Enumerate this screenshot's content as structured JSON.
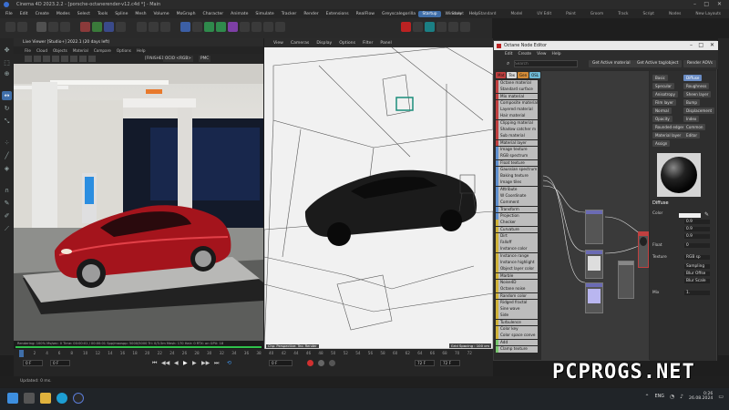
{
  "window": {
    "app_title": "Cinema 4D 2023.2.2 - [porsche-octanerender-v12.c4d *] - Main"
  },
  "menubar": {
    "items": [
      "File",
      "Edit",
      "Create",
      "Modes",
      "Select",
      "Tools",
      "Spline",
      "Mesh",
      "Volume",
      "MoGraph",
      "Character",
      "Animate",
      "Simulate",
      "Tracker",
      "Render",
      "Extensions",
      "RealFlow",
      "Greyscalegorilla",
      "Octane",
      "Window",
      "Help"
    ]
  },
  "layouts": {
    "tabs": [
      "Startup",
      "Sculpt",
      "Standard",
      "Model",
      "UV Edit",
      "Paint",
      "Groom",
      "Track",
      "Script",
      "Nodes"
    ],
    "active": "Startup",
    "new_layouts_label": "New Layouts"
  },
  "live_viewer": {
    "title": "Live Viewer [Studio+] 2022.1 (20 days left)",
    "menu": [
      "File",
      "Cloud",
      "Objects",
      "Material",
      "Compare",
      "Options",
      "Help"
    ],
    "mode": "[FINISHED]",
    "color_space": "OCIO <RGB>",
    "pmc": "PMC",
    "status": "Rendering: 100%  Ms/sec: 0  Time: 00:00:01 / 00:00:01  Spp/maxspp: 5000/5000  Tri: 0/3.5m  Mesh: 170  Hair: 0  RTX: on  GPU: 18",
    "progress": 1.0
  },
  "viewport": {
    "menu": [
      "View",
      "Cameras",
      "Display",
      "Options",
      "Filter",
      "Panel"
    ],
    "footer": "Grid Spacing : 100 cm",
    "label_left": "Chp: Perspective: Tex: Render",
    "scene_note": ""
  },
  "node_editor": {
    "title": "Octane Node Editor",
    "menu": [
      "Edit",
      "Create",
      "View",
      "Help"
    ],
    "search_placeholder": "Search",
    "buttons": [
      "Get Active material",
      "Get Active tag/object",
      "Render AOVs"
    ],
    "category_tabs": [
      {
        "label": "Mat",
        "color": "#c14040"
      },
      {
        "label": "Tex",
        "color": "#d9d9d9"
      },
      {
        "label": "Gen",
        "color": "#d38b38"
      },
      {
        "label": "OSL",
        "color": "#6fb9d4"
      },
      {
        "label": "Map",
        "color": "#d1b33a"
      },
      {
        "label": "Oth",
        "color": "#7a7a7a"
      },
      {
        "label": "Emi",
        "color": "#d973d0"
      },
      {
        "label": "Med",
        "color": "#a47fd9"
      },
      {
        "label": "C4D",
        "color": "#5f90d0"
      },
      {
        "label": "Tex",
        "color": "#78c66e"
      },
      {
        "label": "AOV",
        "color": "#4fbfbf"
      },
      {
        "label": "C4D",
        "color": "#e05050"
      }
    ],
    "node_list": [
      {
        "label": "Octane material",
        "color": "#c14040"
      },
      {
        "label": "Standard surface",
        "color": "#c14040"
      },
      {
        "label": "Mix material",
        "color": "#c14040"
      },
      {
        "label": "Composite material",
        "color": "#c14040"
      },
      {
        "label": "Layered material",
        "color": "#c14040"
      },
      {
        "label": "Hair material",
        "color": "#c14040"
      },
      {
        "label": "Clipping material",
        "color": "#c14040"
      },
      {
        "label": "Shadow catcher m",
        "color": "#c14040"
      },
      {
        "label": "Sub material",
        "color": "#c14040"
      },
      {
        "label": "Material layer",
        "color": "#c14040"
      },
      {
        "label": "Image texture",
        "color": "#5f90d0"
      },
      {
        "label": "RGB spectrum",
        "color": "#5f90d0"
      },
      {
        "label": "Float texture",
        "color": "#5f90d0"
      },
      {
        "label": "Gaussian spectrum",
        "color": "#5f90d0"
      },
      {
        "label": "Baking texture",
        "color": "#5f90d0"
      },
      {
        "label": "Image tiles",
        "color": "#5f90d0"
      },
      {
        "label": "Attribute",
        "color": "#5f90d0"
      },
      {
        "label": "W Coordinate",
        "color": "#5f90d0"
      },
      {
        "label": "Comment",
        "color": "#5f90d0"
      },
      {
        "label": "Transform",
        "color": "#5f90d0"
      },
      {
        "label": "Projection",
        "color": "#5f90d0"
      },
      {
        "label": "Checker",
        "color": "#d1b33a"
      },
      {
        "label": "Curvature",
        "color": "#d1b33a"
      },
      {
        "label": "Dirt",
        "color": "#d1b33a"
      },
      {
        "label": "Falloff",
        "color": "#d1b33a"
      },
      {
        "label": "Instance color",
        "color": "#d1b33a"
      },
      {
        "label": "Instance range",
        "color": "#d1b33a"
      },
      {
        "label": "Instance highlight",
        "color": "#d1b33a"
      },
      {
        "label": "Object layer color",
        "color": "#d1b33a"
      },
      {
        "label": "Marble",
        "color": "#d1b33a"
      },
      {
        "label": "Noise4D",
        "color": "#d1b33a"
      },
      {
        "label": "Octane noise",
        "color": "#d1b33a"
      },
      {
        "label": "Random color",
        "color": "#d1b33a"
      },
      {
        "label": "Ridged fractal",
        "color": "#d1b33a"
      },
      {
        "label": "Sine wave",
        "color": "#d1b33a"
      },
      {
        "label": "Side",
        "color": "#d1b33a"
      },
      {
        "label": "Turbulence",
        "color": "#d1b33a"
      },
      {
        "label": "Color key",
        "color": "#d1b33a"
      },
      {
        "label": "Color space conve",
        "color": "#d1b33a"
      },
      {
        "label": "Add",
        "color": "#78c66e"
      },
      {
        "label": "Clamp texture",
        "color": "#78c66e"
      }
    ],
    "property_tabs": [
      "Basic",
      "Diffuse",
      "Specular",
      "Roughness",
      "Anisotropy",
      "Sheen layer",
      "Film layer",
      "Bump",
      "Normal",
      "Displacement",
      "Opacity",
      "Index",
      "Rounded edges",
      "Common",
      "Material layer",
      "Editor",
      "Assign"
    ],
    "active_property_tab": "Diffuse",
    "section_title": "Diffuse",
    "props": [
      {
        "label": "Color",
        "value": ""
      },
      {
        "label": "",
        "value": "0.9"
      },
      {
        "label": "",
        "value": "0.9"
      },
      {
        "label": "",
        "value": "0.9"
      },
      {
        "label": "Float",
        "value": "0"
      },
      {
        "label": "Texture",
        "value": "RGB sp"
      },
      {
        "label": "",
        "value": "Sampling"
      },
      {
        "label": "",
        "value": "Blur Offse"
      },
      {
        "label": "",
        "value": "Blur Scale"
      },
      {
        "label": "Mix",
        "value": "1."
      }
    ]
  },
  "timeline": {
    "ticks": [
      "0",
      "2",
      "4",
      "6",
      "8",
      "10",
      "12",
      "14",
      "16",
      "18",
      "20",
      "22",
      "24",
      "26",
      "28",
      "30",
      "32",
      "34",
      "36",
      "38",
      "40",
      "42",
      "44",
      "46",
      "48",
      "50",
      "52",
      "54",
      "56",
      "58",
      "60",
      "62",
      "64",
      "66",
      "68",
      "70",
      "72"
    ],
    "start_frame": "0 F",
    "current_frame": "0 F",
    "end_frame": "72 F",
    "end_frame_2": "72 F",
    "preview_start": "0 F"
  },
  "statusbar": {
    "text": "Updated: 0 ms."
  },
  "taskbar": {
    "lang": "ENG",
    "time": "0:26",
    "date": "26.08.2024"
  },
  "watermark": {
    "text": "PCPROGS.NET"
  }
}
